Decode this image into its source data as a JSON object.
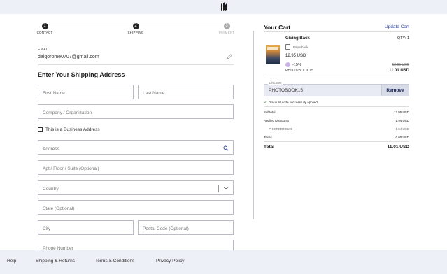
{
  "header": {
    "logo_icon": "bookshop-logo-icon"
  },
  "progress": {
    "steps": [
      {
        "number": "1",
        "label": "CONTACT",
        "state": "done"
      },
      {
        "number": "2",
        "label": "SHIPPING",
        "state": "current"
      },
      {
        "number": "3",
        "label": "PAYMENT",
        "state": "todo"
      }
    ]
  },
  "contact": {
    "email_label": "EMAIL",
    "email_value": "daigorome0707@gmail.com"
  },
  "shipping": {
    "title": "Enter Your Shipping Address",
    "first_name_placeholder": "First Name",
    "last_name_placeholder": "Last Name",
    "company_placeholder": "Company / Organization",
    "business_label": "This is a Business Address",
    "address_placeholder": "Address",
    "apt_placeholder": "Apt / Floor / Suite (Optional)",
    "country_placeholder": "Country",
    "state_placeholder": "State (Optional)",
    "city_placeholder": "City",
    "postal_placeholder": "Postal Code (Optional)",
    "phone_placeholder": "Phone Number"
  },
  "cart": {
    "title": "Your Cart",
    "update_label": "Update Cart",
    "item": {
      "title": "Giving Back",
      "qty": "QTY: 1",
      "format": "Paperback",
      "price": "12.95 USD",
      "discount_pct": "-15%",
      "discount_code": "PHOTOBOOK15",
      "old_price": "12.95 USD",
      "new_price": "11.01 USD"
    },
    "discount": {
      "label": "Discount",
      "value": "PHOTOBOOK15",
      "remove_label": "Remove",
      "success_msg": "Discount code successfully applied"
    },
    "summary": {
      "subtotal_label": "Subtotal",
      "subtotal_value": "12.95 USD",
      "discounts_label": "Applied Discounts",
      "discounts_value": "-1.94 USD",
      "code_label": "PHOTOBOOK15",
      "code_value": "-1.94 USD",
      "taxes_label": "Taxes",
      "taxes_value": "0.00 USD",
      "total_label": "Total",
      "total_value": "11.01 USD"
    }
  },
  "footer": {
    "help": "Help",
    "shipping_returns": "Shipping & Returns",
    "terms": "Terms & Conditions",
    "privacy": "Privacy Policy"
  },
  "colors": {
    "accent": "#2a3fa0",
    "topbar": "#eef0f7",
    "remove_text": "#1d2858"
  }
}
